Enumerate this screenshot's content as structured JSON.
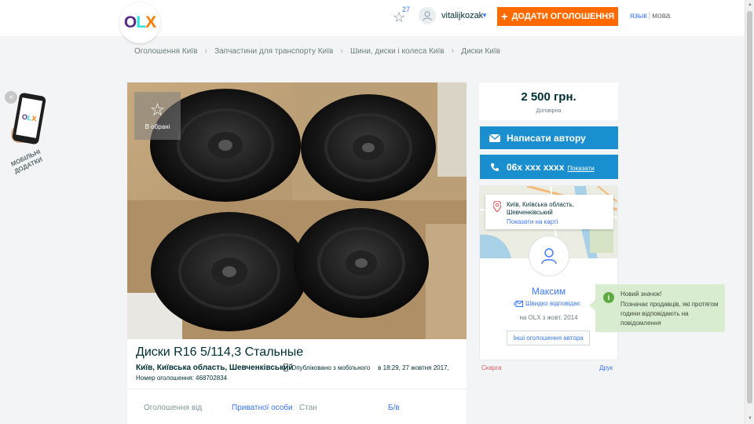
{
  "header": {
    "logo": {
      "o": "O",
      "l": "L",
      "x": "X"
    },
    "favorites_count": "27",
    "username": "vitalijkozak",
    "add_button": "ДОДАТИ ОГОЛОШЕННЯ",
    "lang_link": "язык",
    "lang_current": "мова"
  },
  "breadcrumbs": [
    "Оголошення Київ",
    "Запчастини для транспорту Київ",
    "Шини, диски і колеса Київ",
    "Диски Київ"
  ],
  "mobile_promo": {
    "close": "×",
    "text": "МОБІЛЬНІ ДОДАТКИ"
  },
  "gallery": {
    "fav_label": "В обрані"
  },
  "listing": {
    "title": "Диски R16 5/114,3 Стальные",
    "location": "Київ, Київська область, Шевченківський",
    "published": "Опубліковано з мобільного",
    "time": "в 18:29, 27 жовтня 2017,",
    "ad_number": "Номер оголошення: 468702834",
    "params": [
      {
        "label": "Оголошення від",
        "value": "Приватної особи"
      },
      {
        "label": "Стан",
        "value": "Б/в"
      }
    ]
  },
  "price": {
    "value": "2 500 грн.",
    "note": "Договірна"
  },
  "actions": {
    "write": "Написати автору",
    "phone": "06x xxx xxxx",
    "show": "Показати"
  },
  "map": {
    "address": "Київ, Київська область, Шевченківський",
    "show_map": "Показати на карті"
  },
  "seller": {
    "name": "Максим",
    "quick_reply": "Швидко відповідає",
    "since": "на OLX з жовт. 2014",
    "other_ads": "Інші оголошення автора"
  },
  "footer_links": {
    "complain": "Скарга",
    "print": "Друк"
  },
  "tooltip": {
    "title": "Новий значок!",
    "body": "Позначає продавців, які протягом години відповідають на повідомлення"
  },
  "colors": {
    "accent_orange": "#ff6a00",
    "button_blue": "#1a8fd0",
    "link_blue": "#3a77ff",
    "tooltip_bg": "#d8eccf"
  }
}
